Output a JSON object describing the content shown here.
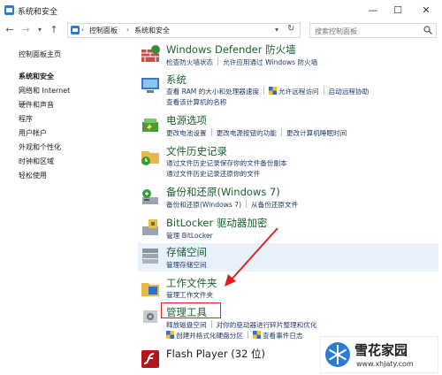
{
  "window": {
    "title": "系统和安全"
  },
  "nav": {
    "breadcrumb": [
      "控制面板",
      "系统和安全"
    ],
    "search_placeholder": "搜索控制面板"
  },
  "sidebar": {
    "home": "控制面板主页",
    "items": [
      "系统和安全",
      "网络和 Internet",
      "硬件和声音",
      "程序",
      "用户帐户",
      "外观和个性化",
      "时钟和区域",
      "轻松使用"
    ]
  },
  "entries": [
    {
      "title": "Windows Defender 防火墙",
      "links": [
        [
          "检查防火墙状态",
          "允许应用通过 Windows 防火墙"
        ]
      ]
    },
    {
      "title": "系统",
      "links": [
        [
          "查看 RAM 的大小和处理器速度",
          "允许远程访问",
          "启动远程协助"
        ],
        [
          "查看该计算机的名称"
        ]
      ]
    },
    {
      "title": "电源选项",
      "links": [
        [
          "更改电池设置",
          "更改电源按钮的功能",
          "更改计算机睡眠时间"
        ]
      ]
    },
    {
      "title": "文件历史记录",
      "links": [
        [
          "通过文件历史记录保存你的文件备份副本"
        ],
        [
          "通过文件历史记录还原你的文件"
        ]
      ]
    },
    {
      "title": "备份和还原(Windows 7)",
      "links": [
        [
          "备份和还原(Windows 7)",
          "从备份还原文件"
        ]
      ]
    },
    {
      "title": "BitLocker 驱动器加密",
      "links": [
        [
          "管理 BitLocker"
        ]
      ]
    },
    {
      "title": "存储空间",
      "links": [
        [
          "管理存储空间"
        ]
      ]
    },
    {
      "title": "工作文件夹",
      "links": [
        [
          "管理工作文件夹"
        ]
      ]
    },
    {
      "title": "管理工具",
      "links": [
        [
          "释放磁盘空间",
          "对你的驱动器进行碎片整理和优化"
        ],
        [
          "创建并格式化硬盘分区",
          "查看事件日志"
        ]
      ]
    },
    {
      "title": "Flash Player (32 位)",
      "links": []
    }
  ],
  "watermark": {
    "name": "雪花家园",
    "url": "www.xhjaty.com"
  },
  "colors": {
    "heading": "#1a5e2e",
    "link": "#1f3a66",
    "highlight_box": "#e02020"
  }
}
